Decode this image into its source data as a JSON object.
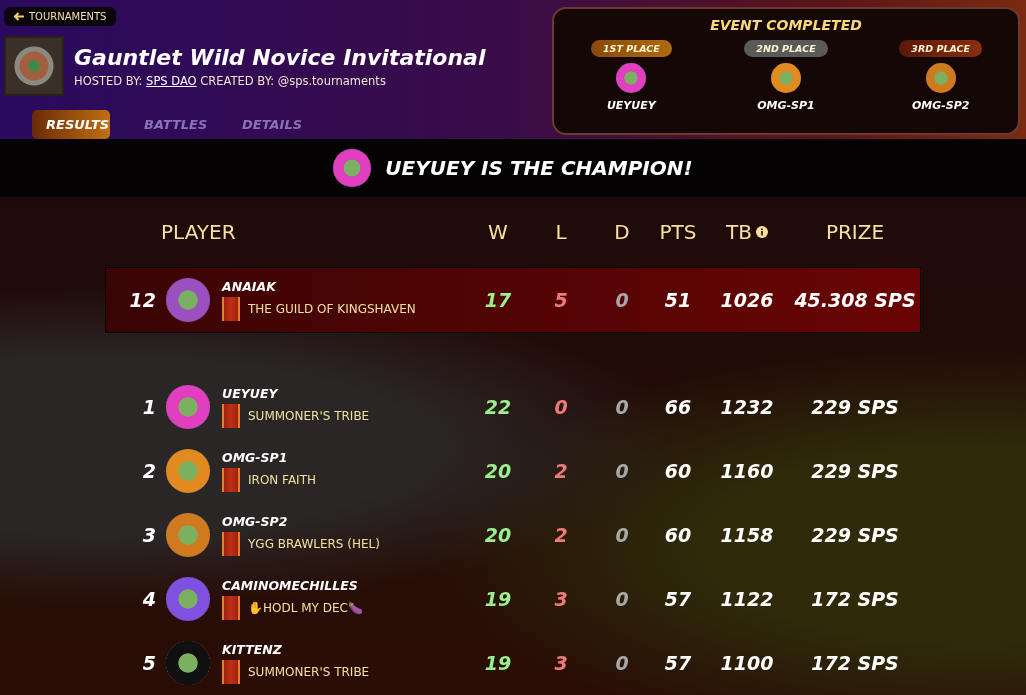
{
  "back_link": {
    "label": "TOURNAMENTS"
  },
  "tournament": {
    "title": "Gauntlet Wild Novice Invitational",
    "hosted_label": "HOSTED BY:",
    "host": "SPS DAO",
    "created_label": "CREATED BY:",
    "creator": "@sps.tournaments"
  },
  "tabs": [
    {
      "label": "RESULTS",
      "selected": true
    },
    {
      "label": "BATTLES",
      "selected": false
    },
    {
      "label": "DETAILS",
      "selected": false
    }
  ],
  "event": {
    "title": "EVENT COMPLETED",
    "podium": [
      {
        "place": "1ST PLACE",
        "kind": "gold",
        "player": "UEYUEY"
      },
      {
        "place": "2ND PLACE",
        "kind": "silver",
        "player": "OMG-SP1"
      },
      {
        "place": "3RD PLACE",
        "kind": "bronze",
        "player": "OMG-SP2"
      }
    ]
  },
  "champion_banner": "UEYUEY IS THE CHAMPION!",
  "table": {
    "columns": [
      "PLAYER",
      "W",
      "L",
      "D",
      "PTS",
      "TB",
      "PRIZE"
    ],
    "own_row": {
      "rank": "12",
      "player": "ANAIAK",
      "guild": "THE GUILD OF KINGSHAVEN",
      "w": "17",
      "l": "5",
      "d": "0",
      "pts": "51",
      "tb": "1026",
      "prize": "45.308 SPS"
    },
    "rows": [
      {
        "rank": "1",
        "player": "UEYUEY",
        "guild": "SUMMONER'S TRIBE",
        "w": "22",
        "l": "0",
        "d": "0",
        "pts": "66",
        "tb": "1232",
        "prize": "229 SPS"
      },
      {
        "rank": "2",
        "player": "OMG-SP1",
        "guild": "IRON FAITH",
        "w": "20",
        "l": "2",
        "d": "0",
        "pts": "60",
        "tb": "1160",
        "prize": "229 SPS"
      },
      {
        "rank": "3",
        "player": "OMG-SP2",
        "guild": "YGG BRAWLERS (HEL)",
        "w": "20",
        "l": "2",
        "d": "0",
        "pts": "60",
        "tb": "1158",
        "prize": "229 SPS"
      },
      {
        "rank": "4",
        "player": "CAMINOMECHILLES",
        "guild": "✋HODL MY DEC🍆",
        "w": "19",
        "l": "3",
        "d": "0",
        "pts": "57",
        "tb": "1122",
        "prize": "172 SPS"
      },
      {
        "rank": "5",
        "player": "KITTENZ",
        "guild": "SUMMONER'S TRIBE",
        "w": "19",
        "l": "3",
        "d": "0",
        "pts": "57",
        "tb": "1100",
        "prize": "172 SPS"
      }
    ]
  }
}
